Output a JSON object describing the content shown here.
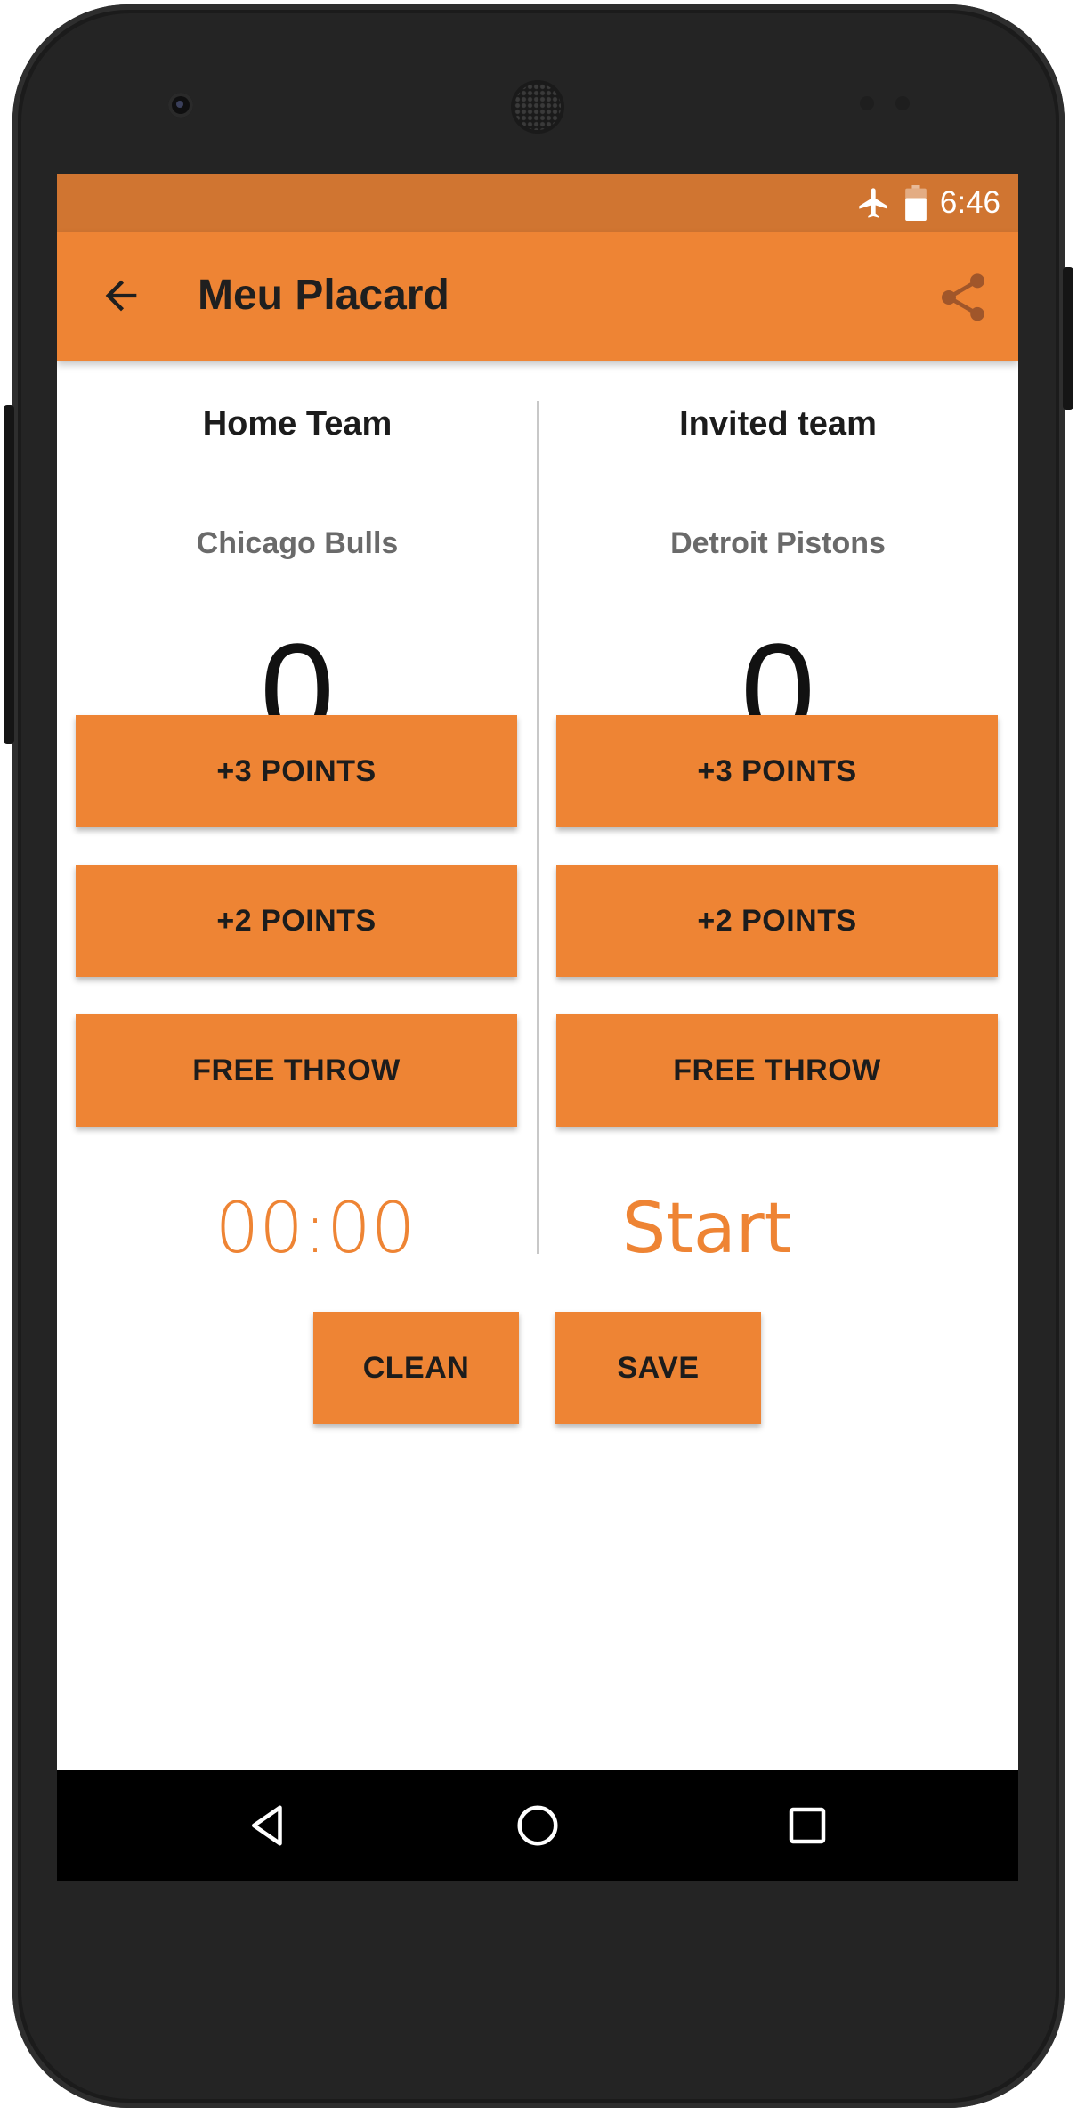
{
  "status_bar": {
    "time": "6:46",
    "icons": [
      "airplane-icon",
      "battery-icon"
    ]
  },
  "toolbar": {
    "title": "Meu Placard",
    "back_icon": "arrow-left-icon",
    "share_icon": "share-icon"
  },
  "home": {
    "label": "Home Team",
    "name": "Chicago Bulls",
    "score": "0"
  },
  "invited": {
    "label": "Invited team",
    "name": "Detroit Pistons",
    "score": "0"
  },
  "buttons": {
    "three": "+3 POINTS",
    "two": "+2 POINTS",
    "free": "FREE THROW",
    "clean": "CLEAN",
    "save": "SAVE"
  },
  "timer": {
    "time": "00:00",
    "start": "Start"
  },
  "navbar": {
    "icons": [
      "back-triangle-icon",
      "home-circle-icon",
      "recents-square-icon"
    ]
  },
  "colors": {
    "accent": "#ee8434",
    "status_bar": "#d07531",
    "text_dark": "#1c1c1c",
    "team_name": "#6a6a6a"
  }
}
